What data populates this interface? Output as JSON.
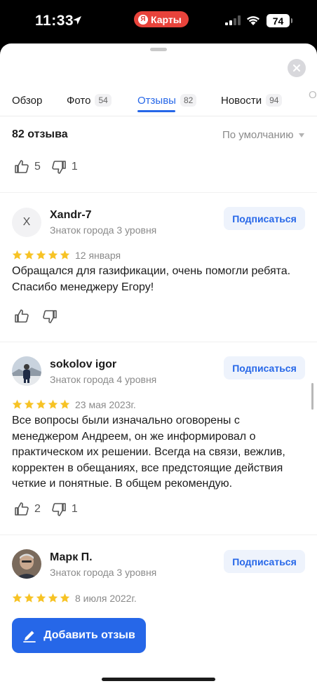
{
  "status_bar": {
    "time": "11:33",
    "app_pill": "Карты",
    "app_pill_logo": "Я",
    "battery": "74"
  },
  "tabs": [
    {
      "label": "Обзор",
      "count": ""
    },
    {
      "label": "Фото",
      "count": "54"
    },
    {
      "label": "Отзывы",
      "count": "82"
    },
    {
      "label": "Новости",
      "count": "94"
    }
  ],
  "tab_partial": "О",
  "reviews_header": {
    "count_label": "82 отзыва",
    "sort_label": "По умолчанию"
  },
  "top_votes": {
    "likes": "5",
    "dislikes": "1"
  },
  "reviews": [
    {
      "avatar_letter": "X",
      "author": "Xandr-7",
      "level": "Знаток города 3 уровня",
      "subscribe": "Подписаться",
      "stars": 5,
      "date": "12 января",
      "text": "Обращался для газификации, очень помогли ребята. Спасибо менеджеру Егору!",
      "likes": "",
      "dislikes": ""
    },
    {
      "avatar_letter": "",
      "author": "sokolov igor",
      "level": "Знаток города 4 уровня",
      "subscribe": "Подписаться",
      "stars": 5,
      "date": "23 мая 2023г.",
      "text": "Все вопросы были изначально оговорены с менеджером Андреем, он же информировал о практическом их решении. Всегда на связи, вежлив, корректен в обещаниях, все предстоящие действия четкие и понятные. В общем рекомендую.",
      "likes": "2",
      "dislikes": "1"
    },
    {
      "avatar_letter": "",
      "author": "Марк П.",
      "level": "Знаток города 3 уровня",
      "subscribe": "Подписаться",
      "stars": 5,
      "date": "8 июля 2022г.",
      "text": "",
      "likes": "",
      "dislikes": ""
    }
  ],
  "add_review_label": "Добавить отзыв",
  "colors": {
    "accent": "#2667e8",
    "star": "#f7c325",
    "pill": "#e8433b"
  }
}
